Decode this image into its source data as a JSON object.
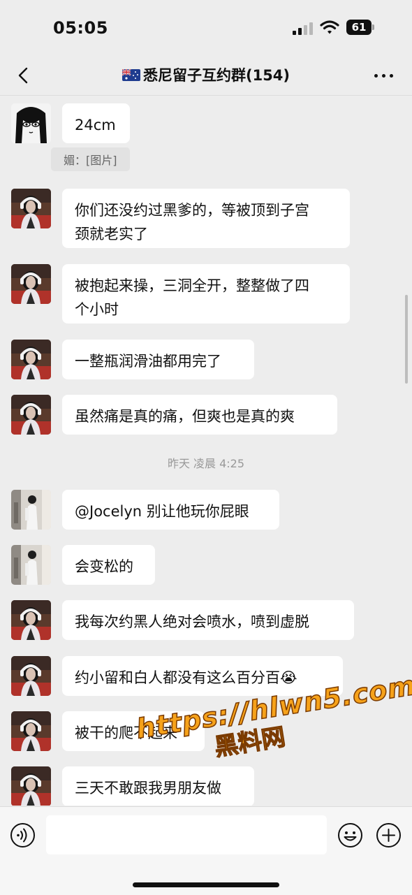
{
  "status": {
    "time": "05:05",
    "battery": "61"
  },
  "header": {
    "title": "悉尼留子互约群(154)",
    "flag_icon": "australia-flag-icon"
  },
  "messages": [
    {
      "text": "24cm",
      "avatar": "manga-girl"
    },
    {
      "quote": "媚：[图片]"
    },
    {
      "text_lines": [
        "你们还没约过黑爹的，等被顶到子宫",
        "颈就老实了"
      ],
      "avatar": "woman-headphones"
    },
    {
      "text_lines": [
        "被抱起来操，三洞全开，整整做了四",
        "个小时"
      ],
      "avatar": "woman-headphones"
    },
    {
      "text": "一整瓶润滑油都用完了",
      "avatar": "woman-headphones"
    },
    {
      "text": "虽然痛是真的痛，但爽也是真的爽",
      "avatar": "woman-headphones"
    },
    {
      "timestamp": "昨天 凌晨 4:25"
    },
    {
      "text": "@Jocelyn 别让他玩你屁眼",
      "avatar": "woman-mirror"
    },
    {
      "text": "会变松的",
      "avatar": "woman-mirror"
    },
    {
      "text": "我每次约黑人绝对会喷水，喷到虚脱",
      "avatar": "woman-headphones"
    },
    {
      "text": "约小留和白人都没有这么百分百",
      "emoji": "😭",
      "avatar": "woman-headphones"
    },
    {
      "text": "被干的爬不起来",
      "avatar": "woman-headphones"
    },
    {
      "text": "三天不敢跟我男朋友做",
      "avatar": "woman-headphones"
    }
  ],
  "watermark": {
    "url": "https://hlwn5.com",
    "name": "黑料网"
  },
  "colors": {
    "background": "#ededed",
    "bubble": "#ffffff",
    "watermark": "#f6a21a"
  }
}
